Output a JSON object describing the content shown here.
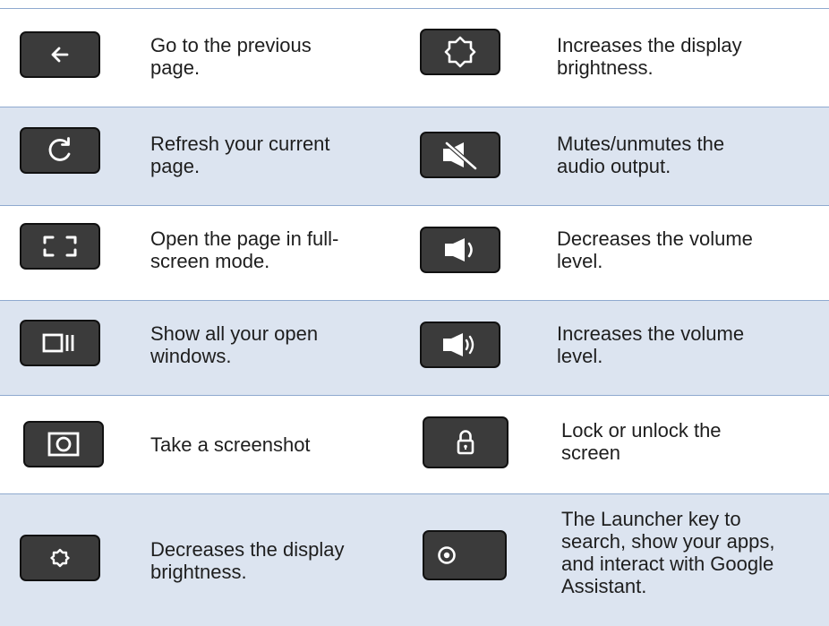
{
  "rows": [
    {
      "left": {
        "icon": "back-arrow-icon",
        "text": "Go to the previous\npage."
      },
      "right": {
        "icon": "brightness-up-icon",
        "text": "Increases the display\nbrightness."
      }
    },
    {
      "left": {
        "icon": "refresh-icon",
        "text": "Refresh your current\npage."
      },
      "right": {
        "icon": "mute-icon",
        "text": "Mutes/unmutes the\naudio output."
      }
    },
    {
      "left": {
        "icon": "fullscreen-icon",
        "text": "Open the page in full-\nscreen mode."
      },
      "right": {
        "icon": "volume-down-icon",
        "text": "Decreases the volume\nlevel."
      }
    },
    {
      "left": {
        "icon": "overview-windows-icon",
        "text": "Show all your open\nwindows."
      },
      "right": {
        "icon": "volume-up-icon",
        "text": "Increases the volume\nlevel."
      }
    },
    {
      "left": {
        "icon": "screenshot-icon",
        "text": "Take a screenshot"
      },
      "right": {
        "icon": "lock-icon",
        "text": "Lock or unlock the\nscreen"
      }
    },
    {
      "left": {
        "icon": "brightness-down-icon",
        "text": "Decreases the display\nbrightness."
      },
      "right": {
        "icon": "launcher-icon",
        "text": "The Launcher key to\nsearch, show your apps,\nand interact with Google\nAssistant."
      }
    }
  ],
  "colors": {
    "shaded_row": "#dce4f0",
    "rule": "#8fa9cf",
    "key": "#3b3b3b"
  }
}
